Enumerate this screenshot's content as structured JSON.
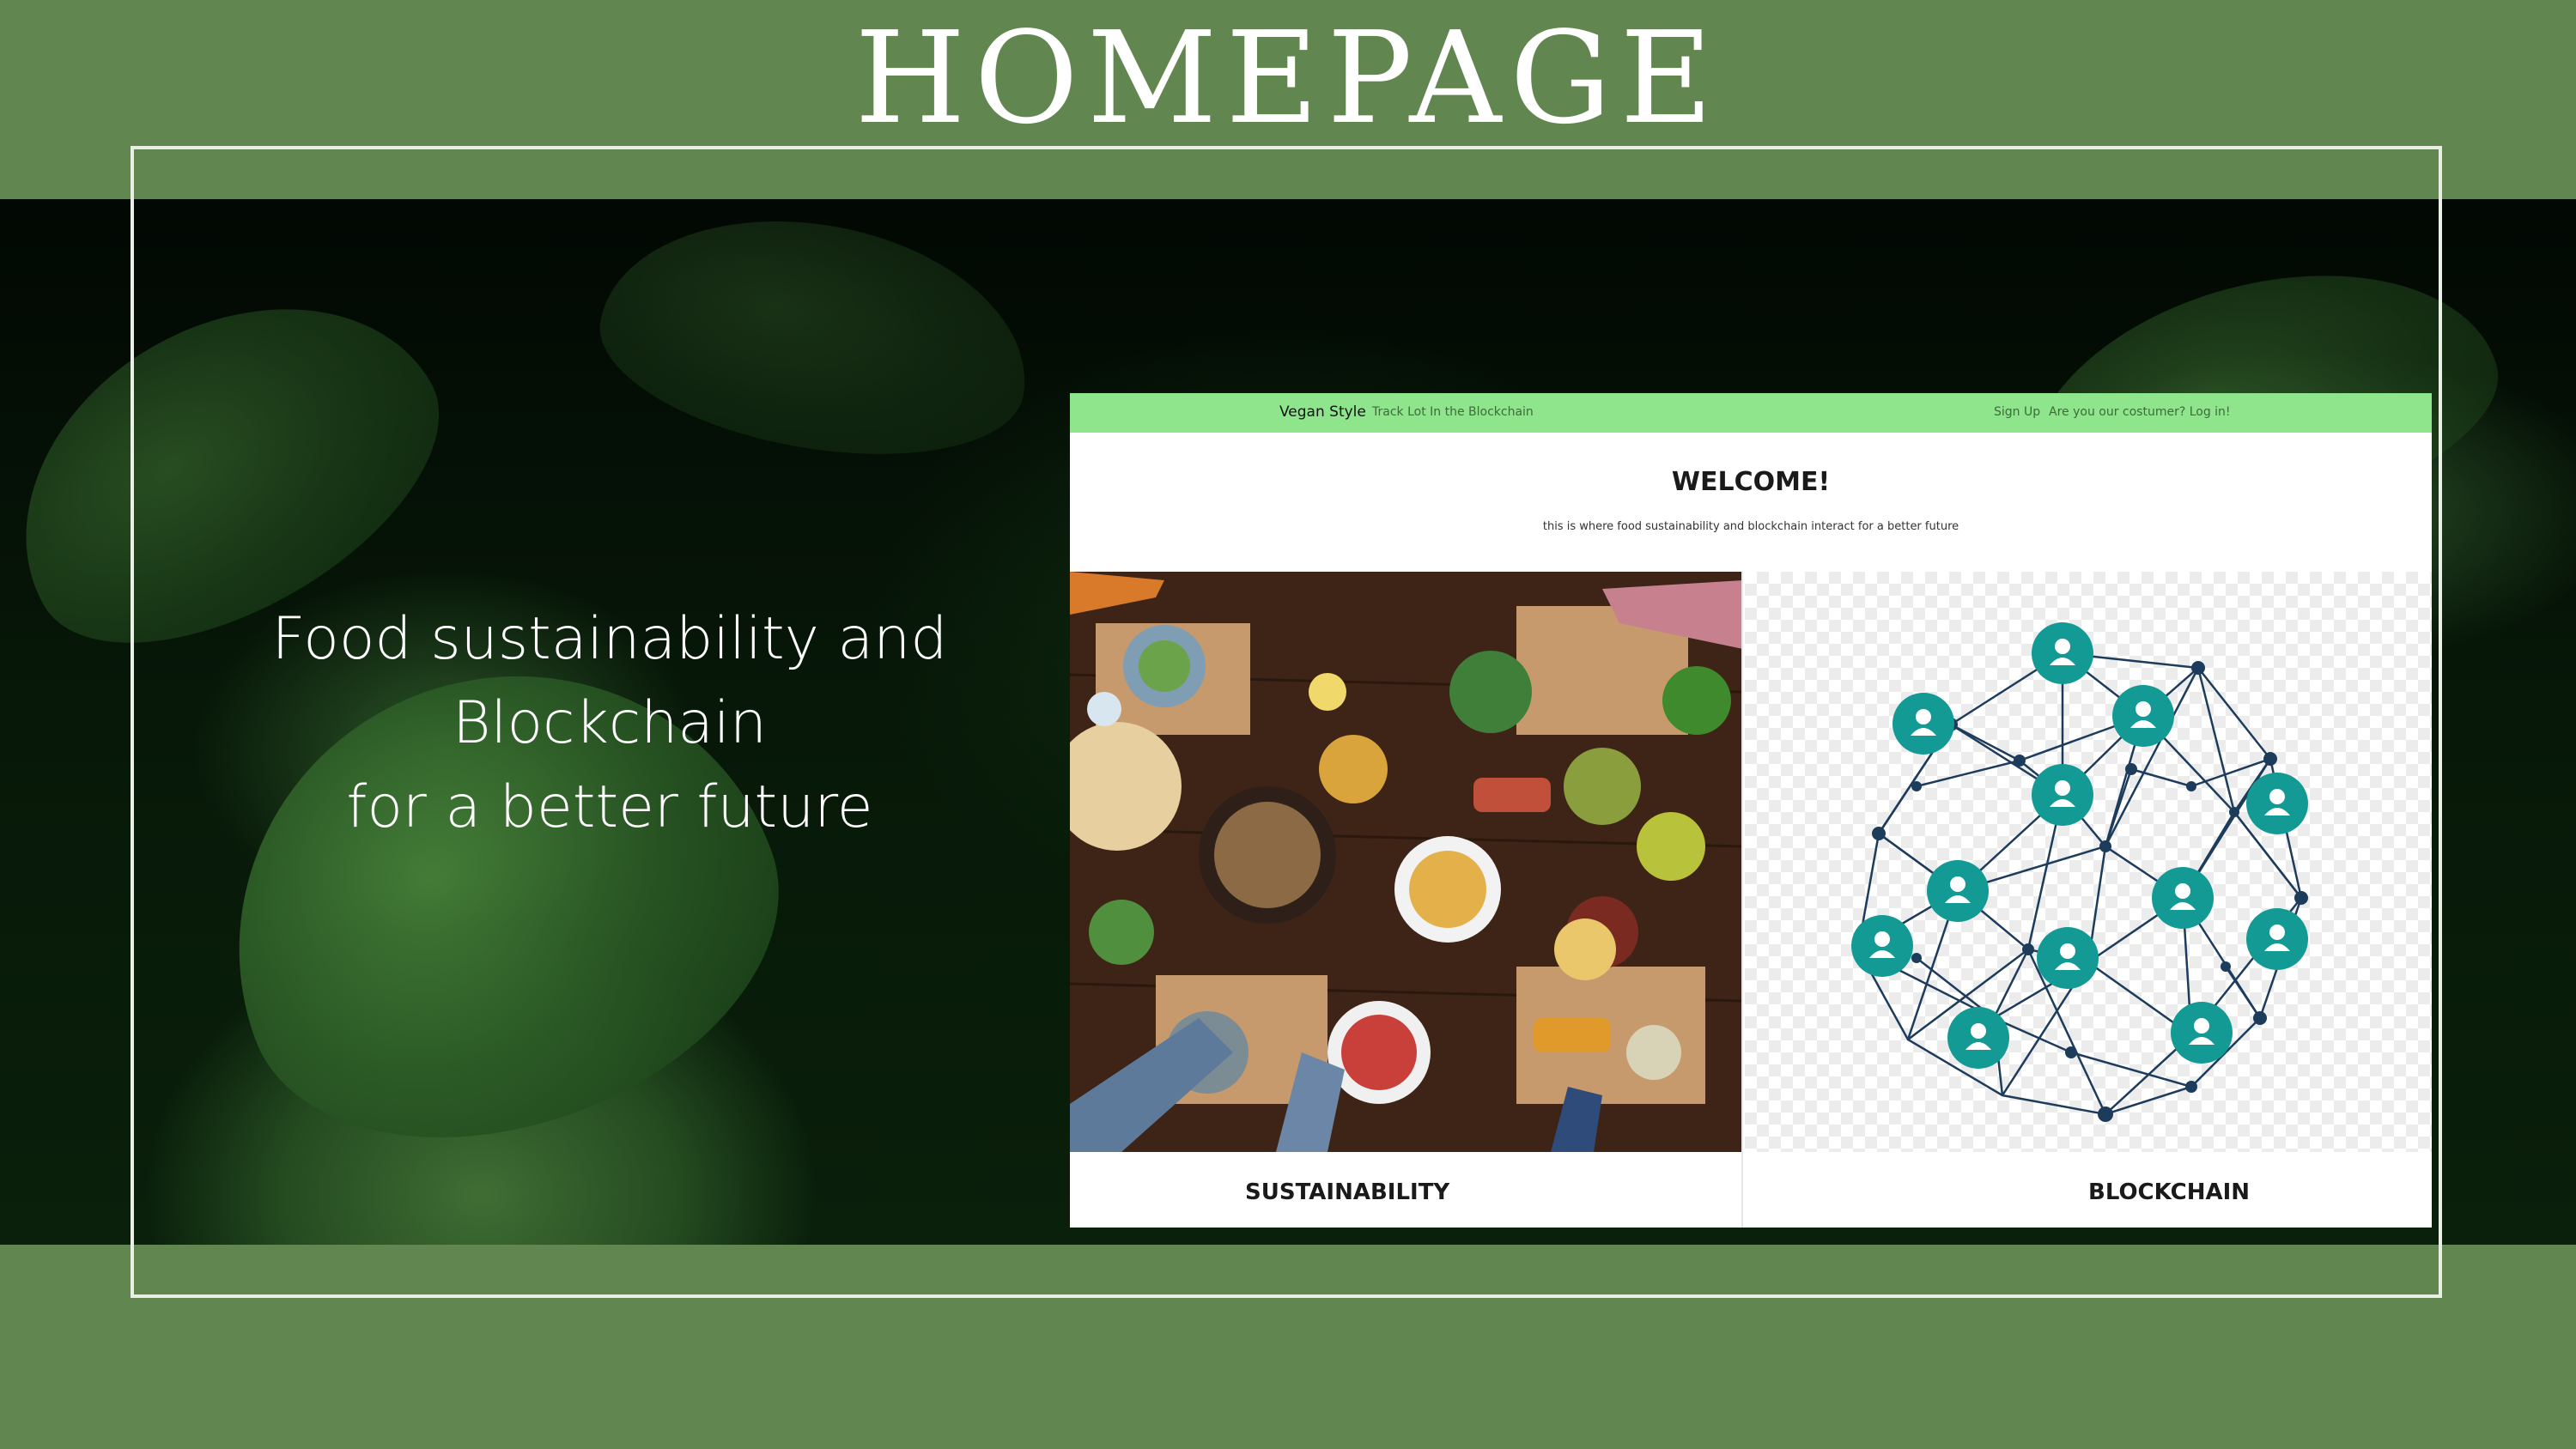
{
  "page": {
    "title": "HOMEPAGE",
    "tagline_lines": [
      "Food sustainability and",
      "Blockchain",
      "for a better future"
    ]
  },
  "mockup": {
    "nav": {
      "brand": "Vegan Style",
      "track_link": "Track Lot In the Blockchain",
      "signup_link": "Sign Up",
      "login_link": "Are you our costumer? Log in!"
    },
    "welcome_title": "WELCOME!",
    "welcome_subtitle": "this is where food sustainability and blockchain interact for a better future",
    "cards": [
      {
        "label": "SUSTAINABILITY",
        "image": "food-table-photo"
      },
      {
        "label": "BLOCKCHAIN",
        "image": "blockchain-network-illustration"
      }
    ]
  },
  "colors": {
    "background": "#62864f",
    "nav": "#8ee58b",
    "node": "#139a94",
    "network_line": "#1d3c5c"
  }
}
